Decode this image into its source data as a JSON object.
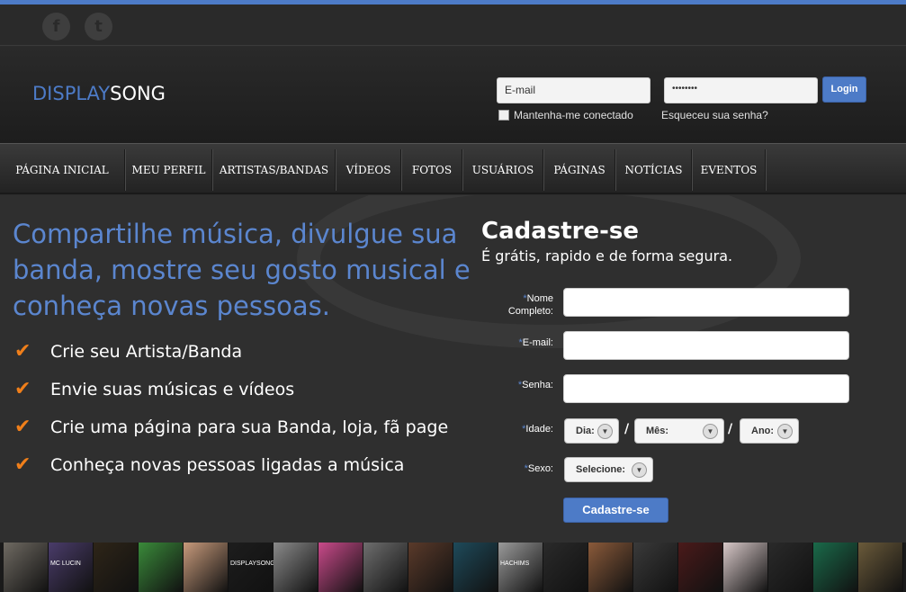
{
  "social": {
    "facebook_glyph": "f",
    "twitter_glyph": "t"
  },
  "logo": {
    "part1": "DISPLAY",
    "part2": "SONG"
  },
  "login": {
    "email_value": "E-mail",
    "password_value": "••••••••",
    "button_label": "Login",
    "remember_label": "Mantenha-me conectado",
    "forgot_label": "Esqueceu sua senha?"
  },
  "nav": [
    "PÁGINA INICIAL",
    "MEU PERFIL",
    "ARTISTAS/BANDAS",
    "VÍDEOS",
    "FOTOS",
    "USUÁRIOS",
    "PÁGINAS",
    "NOTÍCIAS",
    "EVENTOS"
  ],
  "hero": {
    "headline": "Compartilhe música, divulgue sua banda, mostre seu gosto musical e conheça novas pessoas.",
    "features": [
      "Crie seu Artista/Banda",
      "Envie suas músicas e vídeos",
      "Crie uma página para sua Banda, loja, fã page",
      "Conheça novas pessoas ligadas a música"
    ]
  },
  "signup": {
    "title": "Cadastre-se",
    "subtitle": "É grátis, rapido e de forma segura.",
    "name_label_1": "Nome",
    "name_label_2": "Completo:",
    "email_label": "E-mail:",
    "password_label": "Senha:",
    "age_label": "Idade:",
    "sex_label": "Sexo:",
    "required_mark": "*",
    "day_placeholder": "Dia:",
    "month_placeholder": "Mês:",
    "year_placeholder": "Ano:",
    "sex_placeholder": "Selecione:",
    "date_separator": "/",
    "submit_label": "Cadastre-se"
  },
  "thumb_strip": {
    "colors": [
      "#6f6a62",
      "#4a3c6a",
      "#2e2518",
      "#3a8a3a",
      "#c79a7b",
      "#1d1d1d",
      "#8a8a8a",
      "#c94a8a",
      "#6e6e6e",
      "#5a3a2a",
      "#1e4a5a",
      "#9a9a9a",
      "#2a2a2a",
      "#8a5a3a",
      "#3a3a3a",
      "#4a1a1a",
      "#d8c8c8",
      "#2a2a2a",
      "#1a6a4a",
      "#6a5a3a"
    ],
    "labels": {
      "5": "DISPLAYSONG",
      "1": "MC LUCIN",
      "11": "HACHIMS"
    }
  }
}
